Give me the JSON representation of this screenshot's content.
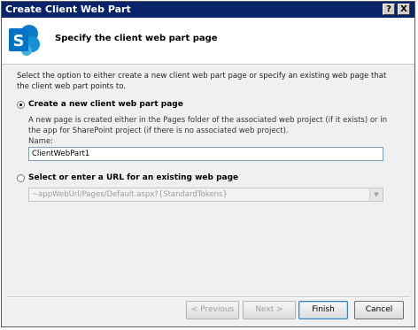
{
  "window": {
    "title": "Create Client Web Part"
  },
  "titlebar_buttons": {
    "help": "?",
    "close": "X"
  },
  "header": {
    "title": "Specify the client web part page",
    "logo_letter": "S"
  },
  "description": "Select the option to either create a new client web part page or specify an existing web page that the client web part points to.",
  "option_new": {
    "label": "Create a new client web part page",
    "selected": true,
    "description": "A new page is created either in the Pages folder of the associated web project (if it exists) or in the app for SharePoint project (if there is no associated web project).",
    "name_label": "Name:",
    "name_value": "ClientWebPart1"
  },
  "option_existing": {
    "label": "Select or enter a URL for an existing web page",
    "selected": false,
    "url_value": "~appWebUrl/Pages/Default.aspx?{StandardTokens}"
  },
  "buttons": {
    "previous": "< Previous",
    "next": "Next >",
    "finish": "Finish",
    "cancel": "Cancel"
  },
  "colors": {
    "titlebar": "#0a246a",
    "logo": "#0072c6"
  }
}
